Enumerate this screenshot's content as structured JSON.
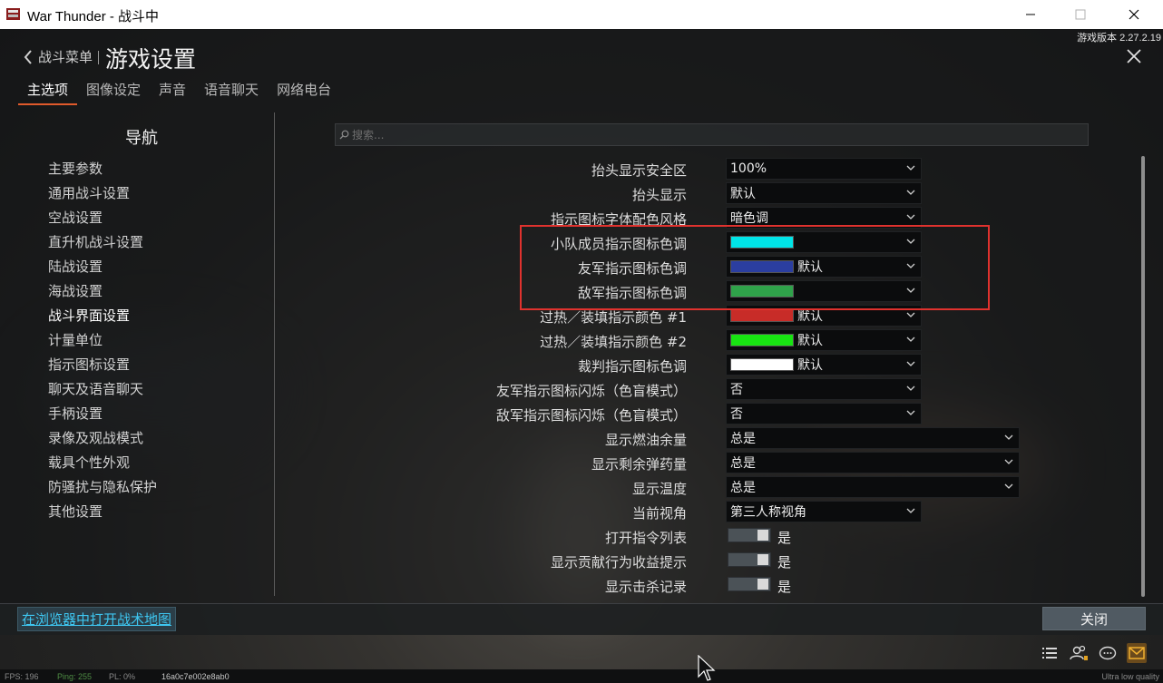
{
  "window": {
    "title": "War Thunder - 战斗中"
  },
  "header": {
    "version": "游戏版本 2.27.2.19",
    "back_label": "战斗菜单",
    "title": "游戏设置"
  },
  "tabs": [
    {
      "label": "主选项",
      "active": true
    },
    {
      "label": "图像设定",
      "active": false
    },
    {
      "label": "声音",
      "active": false
    },
    {
      "label": "语音聊天",
      "active": false
    },
    {
      "label": "网络电台",
      "active": false
    }
  ],
  "nav": {
    "title": "导航",
    "items": [
      {
        "label": "主要参数"
      },
      {
        "label": "通用战斗设置"
      },
      {
        "label": "空战设置"
      },
      {
        "label": "直升机战斗设置"
      },
      {
        "label": "陆战设置"
      },
      {
        "label": "海战设置"
      },
      {
        "label": "战斗界面设置",
        "selected": true
      },
      {
        "label": "计量单位"
      },
      {
        "label": "指示图标设置"
      },
      {
        "label": "聊天及语音聊天"
      },
      {
        "label": "手柄设置"
      },
      {
        "label": "录像及观战模式"
      },
      {
        "label": "载具个性外观"
      },
      {
        "label": "防骚扰与隐私保护"
      },
      {
        "label": "其他设置"
      }
    ]
  },
  "search": {
    "placeholder": "搜索..."
  },
  "settings": [
    {
      "label": "抬头显示安全区",
      "kind": "dropdown",
      "value": "100%",
      "wide": false
    },
    {
      "label": "抬头显示",
      "kind": "dropdown",
      "value": "默认",
      "wide": false
    },
    {
      "label": "指示图标字体配色风格",
      "kind": "dropdown",
      "value": "暗色调",
      "wide": false
    },
    {
      "label": "小队成员指示图标色调",
      "kind": "color",
      "color": "#00e5e8",
      "value": "",
      "wide": false
    },
    {
      "label": "友军指示图标色调",
      "kind": "color",
      "color": "#2b3ea0",
      "value": "默认",
      "wide": false
    },
    {
      "label": "敌军指示图标色调",
      "kind": "color",
      "color": "#2fa24a",
      "value": "",
      "wide": false
    },
    {
      "label": "过热／装填指示颜色 #1",
      "kind": "color",
      "color": "#c82c28",
      "value": "默认",
      "wide": false
    },
    {
      "label": "过热／装填指示颜色 #2",
      "kind": "color",
      "color": "#18e412",
      "value": "默认",
      "wide": false
    },
    {
      "label": "裁判指示图标色调",
      "kind": "color",
      "color": "#ffffff",
      "value": "默认",
      "wide": false
    },
    {
      "label": "友军指示图标闪烁（色盲模式）",
      "kind": "dropdown",
      "value": "否",
      "wide": false
    },
    {
      "label": "敌军指示图标闪烁（色盲模式）",
      "kind": "dropdown",
      "value": "否",
      "wide": false
    },
    {
      "label": "显示燃油余量",
      "kind": "dropdown",
      "value": "总是",
      "wide": true
    },
    {
      "label": "显示剩余弹药量",
      "kind": "dropdown",
      "value": "总是",
      "wide": true
    },
    {
      "label": "显示温度",
      "kind": "dropdown",
      "value": "总是",
      "wide": true
    },
    {
      "label": "当前视角",
      "kind": "dropdown",
      "value": "第三人称视角",
      "wide": false
    },
    {
      "label": "打开指令列表",
      "kind": "toggle",
      "value": "是"
    },
    {
      "label": "显示贡献行为收益提示",
      "kind": "toggle",
      "value": "是"
    },
    {
      "label": "显示击杀记录",
      "kind": "toggle",
      "value": "是"
    }
  ],
  "footer": {
    "map_link": "在浏览器中打开战术地图",
    "close_button": "关闭"
  },
  "status": {
    "fps": "FPS: 196",
    "ping": "Ping: 255",
    "pl": "PL: 0%",
    "hash": "16a0c7e002e8ab0",
    "quality": "Ultra low quality"
  },
  "icons": {
    "app": "war-thunder-app-icon",
    "back": "chevron-left-icon",
    "close": "close-icon",
    "search": "search-icon",
    "list": "list-icon",
    "squad": "squad-icon",
    "chat": "chat-icon",
    "mail": "mail-icon"
  },
  "colors": {
    "tab_accent": "#e05a2b",
    "link": "#3ec6f0",
    "highlight": "#e0322e"
  }
}
